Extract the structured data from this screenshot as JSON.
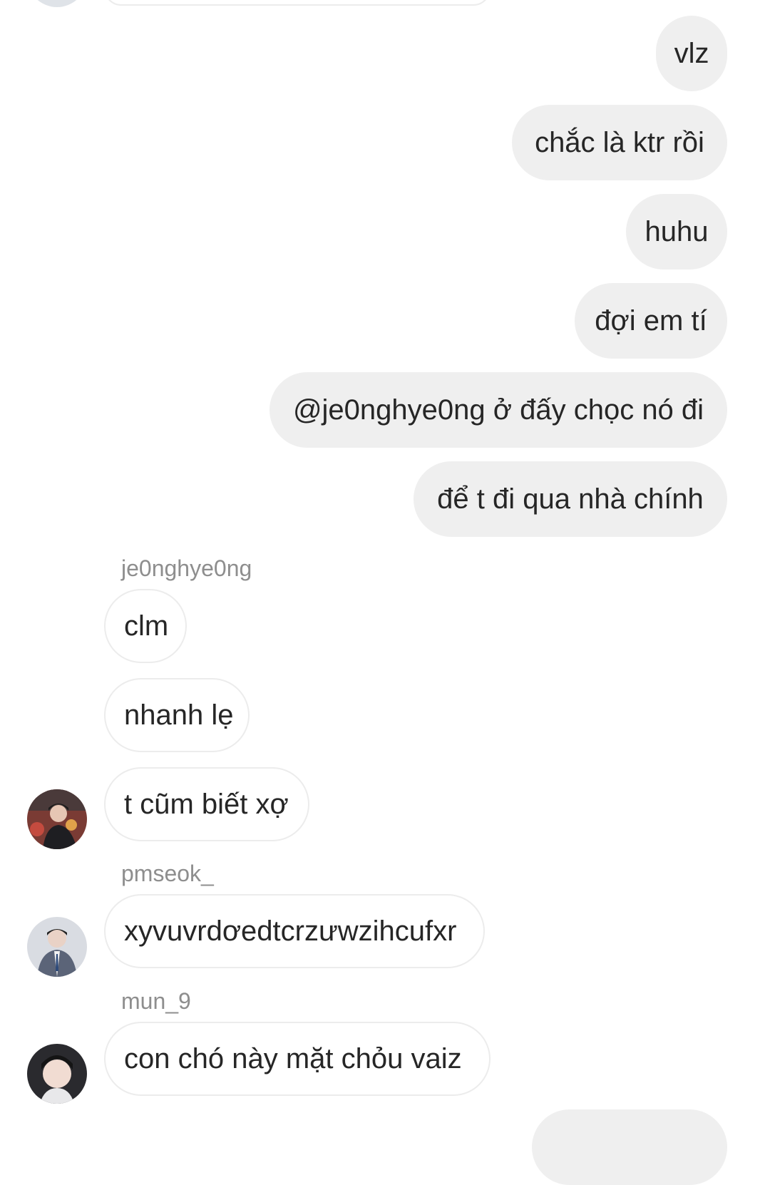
{
  "messages_out": [
    {
      "text": "vlz"
    },
    {
      "text": "chắc là ktr rồi"
    },
    {
      "text": "huhu"
    },
    {
      "text": "đợi em tí"
    },
    {
      "text": "@je0nghye0ng ở đấy chọc nó đi"
    },
    {
      "text": "để t đi qua nhà chính"
    }
  ],
  "threads": [
    {
      "username": "je0nghye0ng",
      "messages": [
        {
          "text": "clm"
        },
        {
          "text": "nhanh lẹ"
        },
        {
          "text": "t cũm biết xợ"
        }
      ],
      "avatar_icon": "user-avatar-photo"
    },
    {
      "username": "pmseok_",
      "messages": [
        {
          "text": "xyvuvrdơedtcrzưwzihcufxr"
        }
      ],
      "avatar_icon": "user-avatar-photo"
    },
    {
      "username": "mun_9",
      "messages": [
        {
          "text": "con chó này mặt chỏu vaiz"
        }
      ],
      "avatar_icon": "user-avatar-photo"
    }
  ],
  "colors": {
    "outgoing_bubble": "#efefef",
    "incoming_border": "#ececec",
    "username": "#8e8e8e",
    "text": "#262626"
  }
}
